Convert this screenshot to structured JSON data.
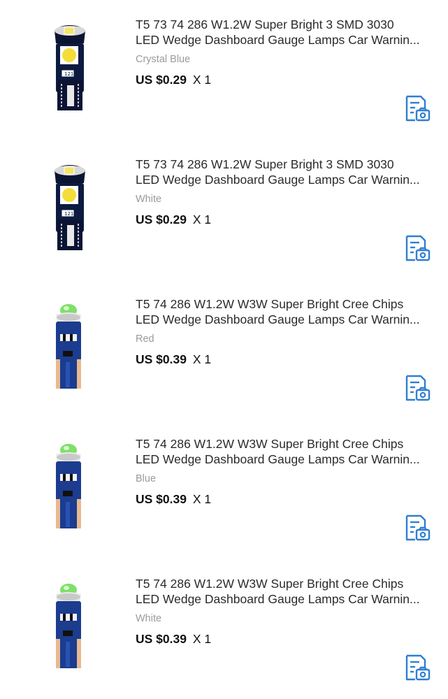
{
  "items": [
    {
      "title_line1": "T5 73 74 286 W1.2W Super Bright 3 SMD 3030",
      "title_line2": "LED Wedge Dashboard Gauge Lamps Car Warnin...",
      "variant": "Crystal Blue",
      "price": "US $0.29",
      "quantity": "X 1",
      "image_type": "smd-led-bulb",
      "icon": "photo-review-icon"
    },
    {
      "title_line1": "T5 73 74 286 W1.2W Super Bright 3 SMD 3030",
      "title_line2": "LED Wedge Dashboard Gauge Lamps Car Warnin...",
      "variant": "White",
      "price": "US $0.29",
      "quantity": "X 1",
      "image_type": "smd-led-bulb",
      "icon": "photo-review-icon"
    },
    {
      "title_line1": "T5 74 286 W1.2W W3W Super Bright Cree Chips",
      "title_line2": "LED Wedge Dashboard Gauge Lamps Car Warnin...",
      "variant": "Red",
      "price": "US $0.39",
      "quantity": "X 1",
      "image_type": "cree-led-bulb",
      "icon": "photo-review-icon"
    },
    {
      "title_line1": "T5 74 286 W1.2W W3W Super Bright Cree Chips",
      "title_line2": "LED Wedge Dashboard Gauge Lamps Car Warnin...",
      "variant": "Blue",
      "price": "US $0.39",
      "quantity": "X 1",
      "image_type": "cree-led-bulb",
      "icon": "photo-review-icon"
    },
    {
      "title_line1": "T5 74 286 W1.2W W3W Super Bright Cree Chips",
      "title_line2": "LED Wedge Dashboard Gauge Lamps Car Warnin...",
      "variant": "White",
      "price": "US $0.39",
      "quantity": "X 1",
      "image_type": "cree-led-bulb",
      "icon": "photo-review-icon"
    }
  ],
  "colors": {
    "accent": "#2f7fd1",
    "variant_text": "#9a9a9a"
  }
}
